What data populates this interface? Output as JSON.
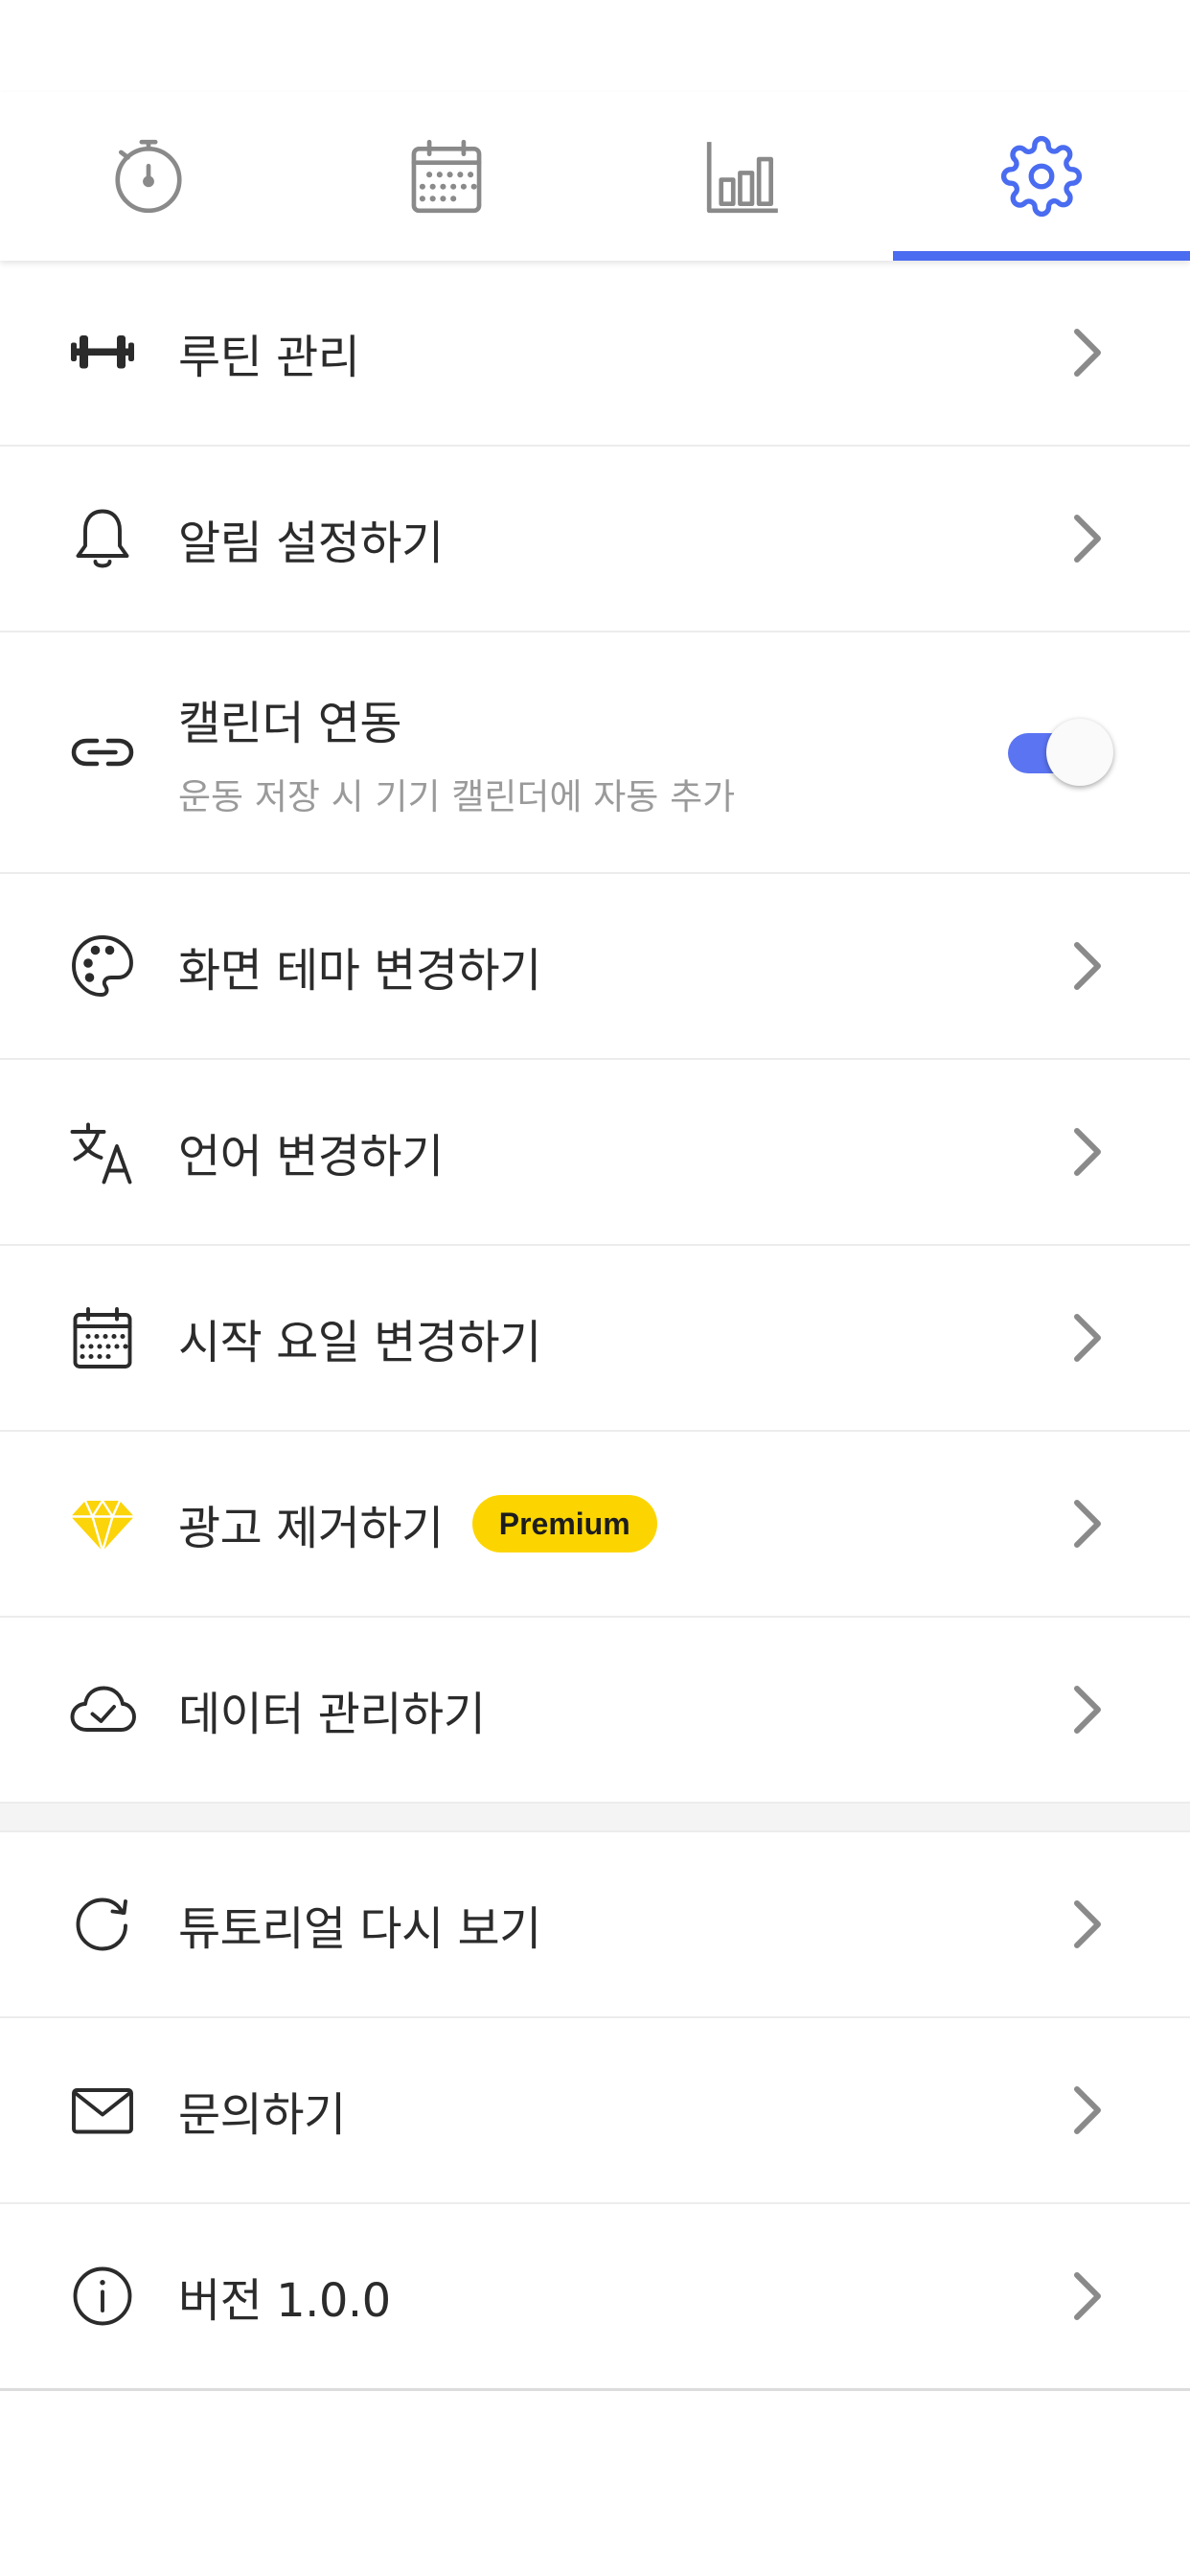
{
  "tabs": [
    {
      "icon": "stopwatch-icon",
      "active": false
    },
    {
      "icon": "calendar-icon",
      "active": false
    },
    {
      "icon": "bar-chart-icon",
      "active": false
    },
    {
      "icon": "gear-icon",
      "active": true
    }
  ],
  "colors": {
    "accent": "#4a6cf0",
    "premium_badge": "#fcd500",
    "diamond": "#fbd40a",
    "text": "#2b2b2b",
    "subtext": "#9a9a9a"
  },
  "menu": {
    "routine": {
      "label": "루틴 관리",
      "icon": "dumbbell-icon"
    },
    "notification": {
      "label": "알림 설정하기",
      "icon": "bell-icon"
    },
    "calendar_sync": {
      "label": "캘린더 연동",
      "description": "운동 저장 시 기기 캘린더에 자동 추가",
      "icon": "link-icon",
      "toggle_on": true
    },
    "theme": {
      "label": "화면 테마 변경하기",
      "icon": "palette-icon"
    },
    "language": {
      "label": "언어 변경하기",
      "icon": "translate-icon"
    },
    "start_day": {
      "label": "시작 요일 변경하기",
      "icon": "calendar-icon"
    },
    "remove_ads": {
      "label": "광고 제거하기",
      "badge": "Premium",
      "icon": "diamond-icon"
    },
    "data": {
      "label": "데이터 관리하기",
      "icon": "cloud-check-icon"
    },
    "tutorial": {
      "label": "튜토리얼 다시 보기",
      "icon": "refresh-icon"
    },
    "contact": {
      "label": "문의하기",
      "icon": "mail-icon"
    },
    "version": {
      "label": "버전 1.0.0",
      "icon": "info-icon"
    }
  }
}
